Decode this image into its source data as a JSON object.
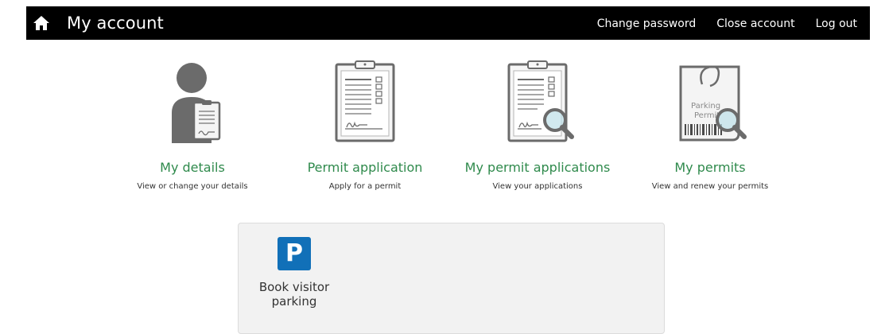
{
  "header": {
    "title": "My account",
    "nav": [
      {
        "label": "Change password"
      },
      {
        "label": "Close account"
      },
      {
        "label": "Log out"
      }
    ]
  },
  "tiles": [
    {
      "title": "My details",
      "description": "View or change your details",
      "icon": "person-with-document-icon"
    },
    {
      "title": "Permit application",
      "description": "Apply for a permit",
      "icon": "clipboard-form-icon"
    },
    {
      "title": "My permit applications",
      "description": "View your applications",
      "icon": "clipboard-search-icon"
    },
    {
      "title": "My permits",
      "description": "View and renew your permits",
      "icon": "parking-permit-search-icon"
    }
  ],
  "permit_tag": {
    "text": "Parking Permit"
  },
  "panel": {
    "visitor_parking": {
      "icon_letter": "P",
      "label": "Book visitor parking"
    }
  },
  "colors": {
    "header_bg": "#000000",
    "link_green": "#2f8a4c",
    "parking_blue": "#1170b8",
    "icon_grey": "#6b6b6b"
  }
}
